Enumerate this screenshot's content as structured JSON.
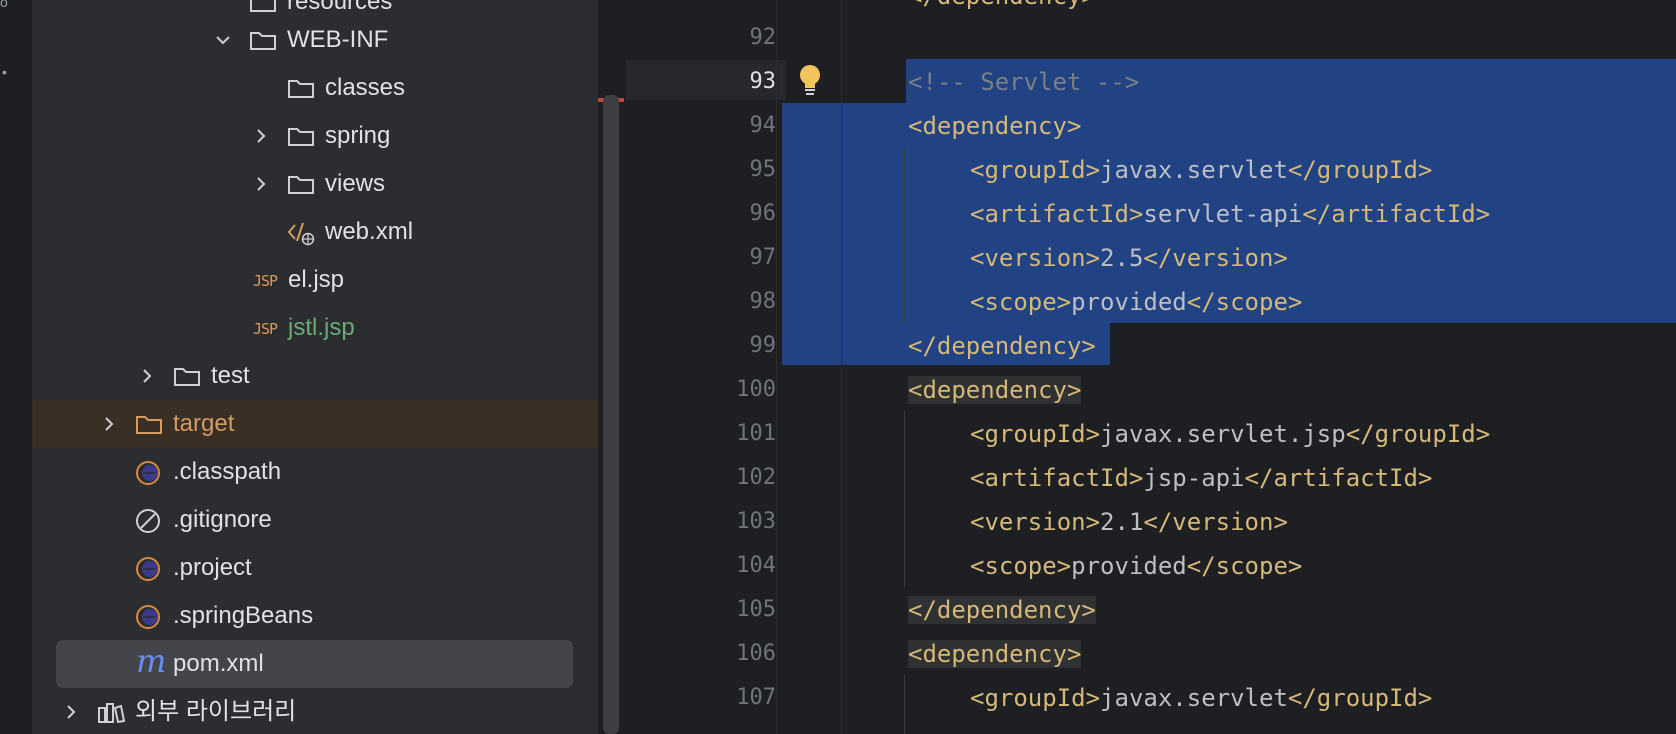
{
  "tree": {
    "items": [
      {
        "label": "resources",
        "type": "folder"
      },
      {
        "label": "WEB-INF",
        "type": "folder",
        "expanded": true
      },
      {
        "label": "classes",
        "type": "folder"
      },
      {
        "label": "spring",
        "type": "folder"
      },
      {
        "label": "views",
        "type": "folder"
      },
      {
        "label": "web.xml",
        "type": "xml"
      },
      {
        "label": "el.jsp",
        "type": "jsp",
        "icon_text": "JSP"
      },
      {
        "label": "jstl.jsp",
        "type": "jsp",
        "icon_text": "JSP",
        "status": "added"
      },
      {
        "label": "test",
        "type": "folder"
      },
      {
        "label": "target",
        "type": "folder",
        "status": "excluded"
      },
      {
        "label": ".classpath",
        "type": "eclipse"
      },
      {
        "label": ".gitignore",
        "type": "ignore"
      },
      {
        "label": ".project",
        "type": "eclipse"
      },
      {
        "label": ".springBeans",
        "type": "eclipse"
      },
      {
        "label": "pom.xml",
        "type": "maven",
        "icon_text": "m",
        "selected": true
      },
      {
        "label": "외부 라이브러리",
        "type": "libraries"
      }
    ]
  },
  "editor": {
    "current_line": "93",
    "lines": [
      {
        "num": "92",
        "text": ""
      },
      {
        "num": "93",
        "text": "<!-- Servlet -->"
      },
      {
        "num": "94",
        "text": "<dependency>"
      },
      {
        "num": "95",
        "open": "<groupId>",
        "value": "javax.servlet",
        "close": "</groupId>"
      },
      {
        "num": "96",
        "open": "<artifactId>",
        "value": "servlet-api",
        "close": "</artifactId>"
      },
      {
        "num": "97",
        "open": "<version>",
        "value": "2.5",
        "close": "</version>"
      },
      {
        "num": "98",
        "open": "<scope>",
        "value": "provided",
        "close": "</scope>"
      },
      {
        "num": "99",
        "text": "</dependency>"
      },
      {
        "num": "100",
        "text": "<dependency>"
      },
      {
        "num": "101",
        "open": "<groupId>",
        "value": "javax.servlet.jsp",
        "close": "</groupId>"
      },
      {
        "num": "102",
        "open": "<artifactId>",
        "value": "jsp-api",
        "close": "</artifactId>"
      },
      {
        "num": "103",
        "open": "<version>",
        "value": "2.1",
        "close": "</version>"
      },
      {
        "num": "104",
        "open": "<scope>",
        "value": "provided",
        "close": "</scope>"
      },
      {
        "num": "105",
        "text": "</dependency>"
      },
      {
        "num": "106",
        "text": "<dependency>"
      },
      {
        "num": "107",
        "open": "<groupId>",
        "value": "javax.servlet",
        "close": "</groupId>"
      }
    ],
    "top_partial": "</dependency>"
  },
  "colors": {
    "selection": "#214283",
    "tag": "#d5b778",
    "comment": "#7a7e85",
    "excluded": "#d39a62",
    "added": "#6aab73",
    "maven": "#6b8cf5"
  }
}
